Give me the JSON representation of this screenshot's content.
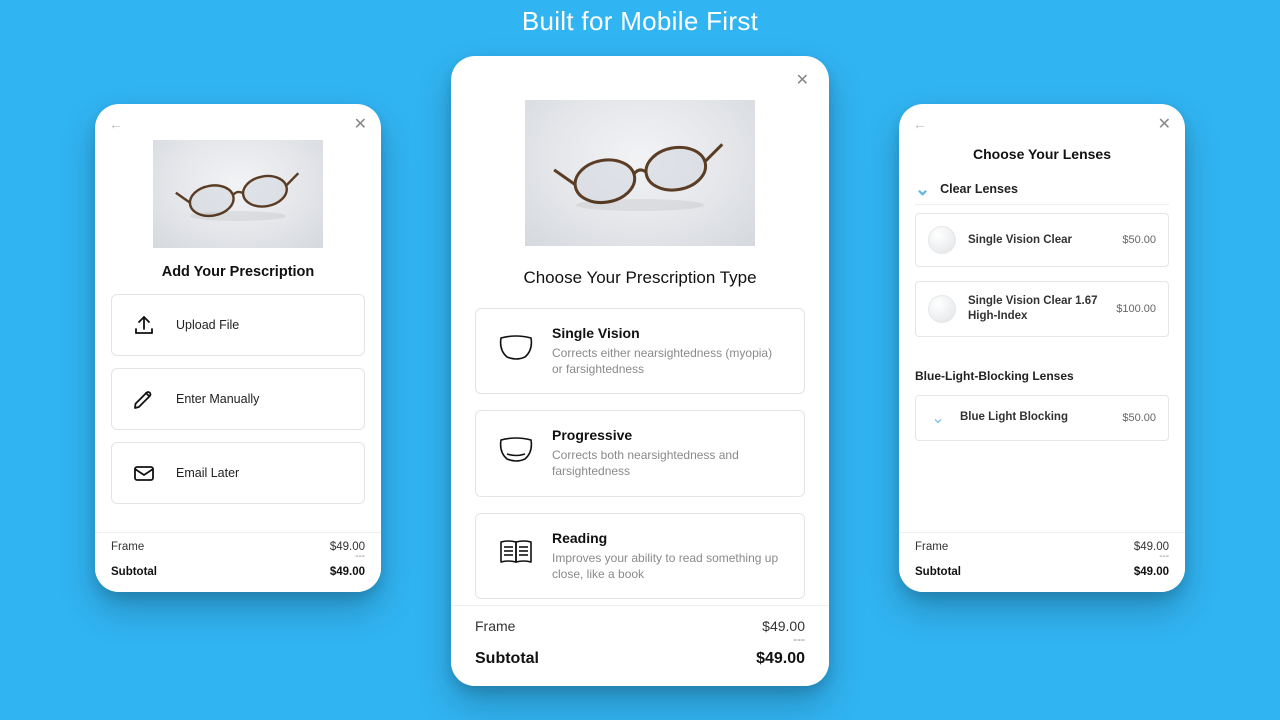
{
  "hero_title": "Built for Mobile First",
  "left": {
    "title": "Add Your Prescription",
    "options": [
      {
        "label": "Upload File"
      },
      {
        "label": "Enter Manually"
      },
      {
        "label": "Email Later"
      }
    ],
    "summary": {
      "frame_label": "Frame",
      "frame_price": "$49.00",
      "dash": "---",
      "subtotal_label": "Subtotal",
      "subtotal_price": "$49.00"
    }
  },
  "center": {
    "title": "Choose Your Prescription Type",
    "options": [
      {
        "label": "Single Vision",
        "desc": "Corrects either nearsightedness (myopia) or farsightedness"
      },
      {
        "label": "Progressive",
        "desc": "Corrects both nearsightedness and farsightedness"
      },
      {
        "label": "Reading",
        "desc": "Improves your ability to read something up close, like a book"
      }
    ],
    "summary": {
      "frame_label": "Frame",
      "frame_price": "$49.00",
      "dash": "---",
      "subtotal_label": "Subtotal",
      "subtotal_price": "$49.00"
    }
  },
  "right": {
    "title": "Choose Your Lenses",
    "section1_label": "Clear Lenses",
    "section1_items": [
      {
        "name": "Single Vision Clear",
        "price": "$50.00"
      },
      {
        "name": "Single Vision Clear 1.67 High-Index",
        "price": "$100.00"
      }
    ],
    "section2_label": "Blue-Light-Blocking Lenses",
    "section2_items": [
      {
        "name": "Blue Light Blocking",
        "price": "$50.00"
      }
    ],
    "summary": {
      "frame_label": "Frame",
      "frame_price": "$49.00",
      "dash": "---",
      "subtotal_label": "Subtotal",
      "subtotal_price": "$49.00"
    }
  }
}
